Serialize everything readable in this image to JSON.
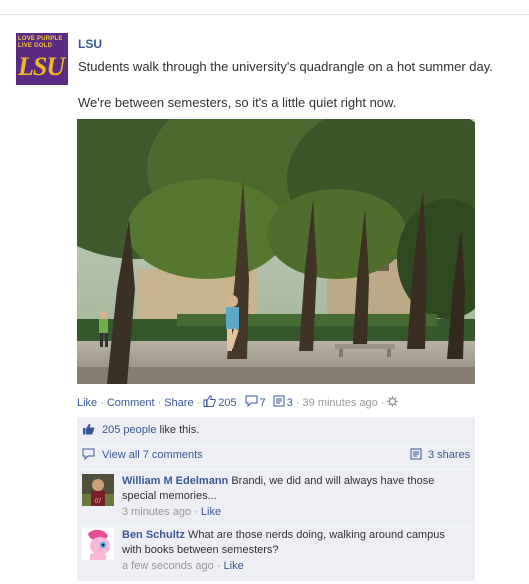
{
  "post": {
    "author": "LSU",
    "avatar_tagline_1": "LOVE PURPLE",
    "avatar_tagline_2": "LIVE GOLD",
    "avatar_logo": "LSU",
    "text_line1": "Students walk through the university's quadrangle on a hot summer day.",
    "text_line2": "We're between semesters, so it's a little quiet right now.",
    "photo_alt": "Students walk through the university's quadrangle"
  },
  "actions": {
    "like": "Like",
    "comment": "Comment",
    "share": "Share",
    "likes_count": "205",
    "comments_count": "7",
    "shares_count": "3",
    "time": "39 minutes ago",
    "separator": "·"
  },
  "ufi": {
    "likes_link": "205 people",
    "likes_suffix": "like this.",
    "view_all": "View all 7 comments",
    "shares": "3 shares",
    "comments": [
      {
        "author": "William M Edelmann",
        "text_inline": "Brandi, we did and will always have those",
        "text_line2": "special memories...",
        "time": "3 minutes ago",
        "like": "Like"
      },
      {
        "author": "Ben Schultz",
        "text_inline": "What are those nerds doing, walking around campus",
        "text_line2": "with books between semesters?",
        "time": "a few seconds ago",
        "like": "Like"
      }
    ]
  },
  "colors": {
    "link": "#3b5998",
    "meta": "#999999",
    "ufi_bg": "#edeff4",
    "lsu_purple": "#5b2b83",
    "lsu_gold": "#f2b81e"
  }
}
